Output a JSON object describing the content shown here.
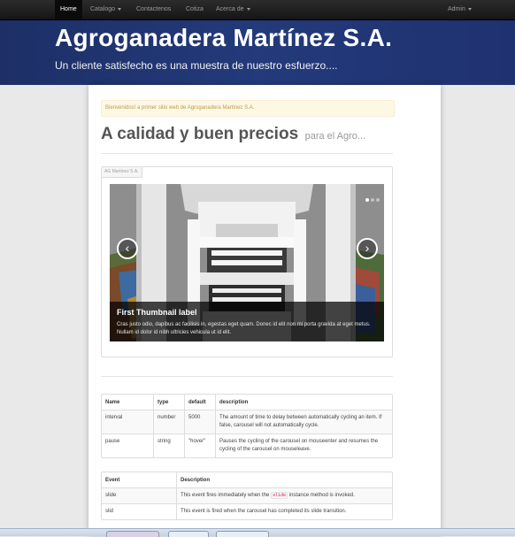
{
  "navbar": {
    "items": [
      "Home",
      "Catalogo",
      "Contactenos",
      "Cotiza",
      "Acerca de"
    ],
    "admin": "Admin"
  },
  "hero": {
    "title": "Agroganadera Martínez S.A.",
    "subtitle": "Un cliente satisfecho es una muestra de nuestro esfuerzo...."
  },
  "alert": "Bienvenidos! a primer sitio web de Agroganadera Martinez S.A.",
  "heading": {
    "main": "A calidad y buen precios",
    "small": "para el Agro..."
  },
  "carousel": {
    "tag": "AG Martinez S.A.",
    "caption_title": "First Thumbnail label",
    "caption_text": "Cras justo odio, dapibus ac facilisis in, egestas eget quam. Donec id elit non mi porta gravida at eget metus. Nullam id dolor id nibh ultricies vehicula ut id elit.",
    "prev": "‹",
    "next": "›",
    "active_slide": 0,
    "slide_count": 3
  },
  "options_table": {
    "headers": [
      "Name",
      "type",
      "default",
      "description"
    ],
    "rows": [
      [
        "interval",
        "number",
        "5000",
        "The amount of time to delay between automatically cycling an item. If false, carousel will not automatically cycle."
      ],
      [
        "pause",
        "string",
        "\"hover\"",
        "Pauses the cycling of the carousel on mouseenter and resumes the cycling of the carousel on mouseleave."
      ]
    ]
  },
  "events_table": {
    "headers": [
      "Event",
      "Description"
    ],
    "rows": [
      {
        "event": "slide",
        "pre": "This event fires immediately when the",
        "code": "slide",
        "post": "instance method is invoked."
      },
      {
        "event": "slid",
        "pre": "This event is fired when the carousel has completed its slide transition.",
        "code": "",
        "post": ""
      }
    ]
  }
}
